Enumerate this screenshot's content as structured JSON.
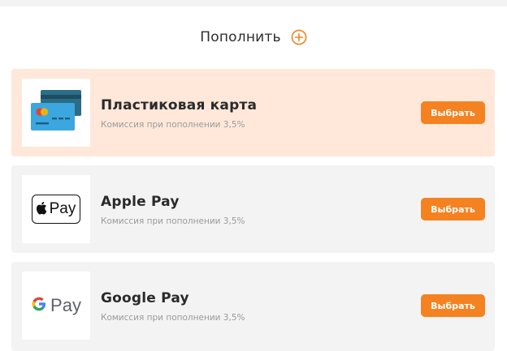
{
  "header": {
    "title": "Пополнить"
  },
  "methods": [
    {
      "name": "Пластиковая карта",
      "fee": "Комиссия при пополнении 3,5%",
      "button": "Выбрать",
      "logo": "credit-card-icon",
      "selected": true
    },
    {
      "name": "Apple Pay",
      "fee": "Комиссия при пополнении 3,5%",
      "button": "Выбрать",
      "logo": "apple-pay-logo",
      "logo_text": "Pay",
      "selected": false
    },
    {
      "name": "Google Pay",
      "fee": "Комиссия при пополнении 3,5%",
      "button": "Выбрать",
      "logo": "google-pay-logo",
      "logo_text": "Pay",
      "selected": false
    }
  ],
  "colors": {
    "accent": "#f58220",
    "selected_bg": "#ffe8da",
    "card_bg": "#f3f3f3"
  }
}
